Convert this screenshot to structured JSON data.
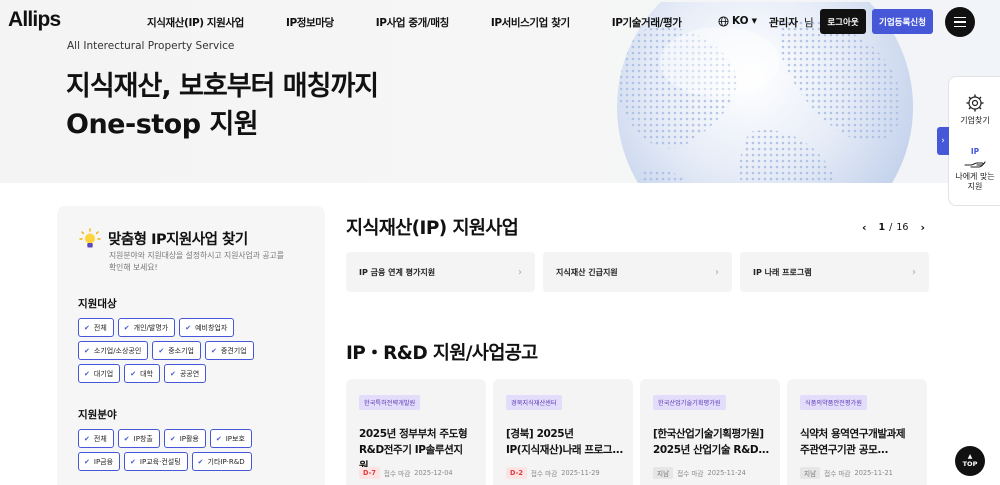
{
  "header": {
    "logo": "Allips",
    "nav": [
      {
        "label": "지식재산(IP) 지원사업"
      },
      {
        "label": "IP정보마당"
      },
      {
        "label": "IP사업 중개/매칭"
      },
      {
        "label": "IP서비스기업 찾기"
      },
      {
        "label": "IP기술거래/평가"
      }
    ],
    "language": "KO",
    "user_name": "관리자",
    "user_suffix": "님",
    "logout_label": "로그아웃",
    "register_label": "기업등록신청"
  },
  "hero": {
    "subtitle": "All Interectural Property Service",
    "title_line1": "지식재산, 보호부터 매칭까지",
    "title_line2": "One-stop 지원"
  },
  "quick_menu": {
    "find_company": "기업찾기",
    "ip_badge": "IP",
    "custom_support_line1": "나에게 맞는",
    "custom_support_line2": "지원"
  },
  "filter": {
    "title": "맞춤형 IP지원사업 찾기",
    "desc_line1": "지원분야와 지원대상을 설정하시고 지원사업과 공고를",
    "desc_line2": "확인해 보세요!",
    "target_title": "지원대상",
    "targets": [
      "전체",
      "개인/발명가",
      "예비창업자",
      "소기업/소상공인",
      "중소기업",
      "중견기업",
      "대기업",
      "대학",
      "공공연"
    ],
    "field_title": "지원분야",
    "fields": [
      "전체",
      "IP창출",
      "IP활용",
      "IP보호",
      "IP금융",
      "IP교육·컨설팅",
      "기타IP·R&D"
    ]
  },
  "programs": {
    "title": "지식재산(IP) 지원사업",
    "page_current": "1",
    "page_sep": "/",
    "page_total": "16",
    "items": [
      {
        "label": "IP 금융 연계 평가지원"
      },
      {
        "label": "지식재산 긴급지원"
      },
      {
        "label": "IP 나래 프로그램"
      }
    ]
  },
  "notices": {
    "title": "IP・R&D 지원/사업공고",
    "deadline_prefix": "접수 마감",
    "items": [
      {
        "org": "한국특허전략개발원",
        "title_line1": "2025년 정부부처 주도형",
        "title_line2": "R&D전주기 IP솔루션지원...",
        "status": "D-7",
        "status_type": "red",
        "deadline": "2025-12-04"
      },
      {
        "org": "경북지식재산센터",
        "title_line1": "[경북] 2025년",
        "title_line2": "IP(지식재산)나래 프로그...",
        "status": "D-2",
        "status_type": "red",
        "deadline": "2025-11-29"
      },
      {
        "org": "한국산업기술기획평가원",
        "title_line1": "[한국산업기술기획평가원]",
        "title_line2": "2025년 산업기술 R&D...",
        "status": "지남",
        "status_type": "gray",
        "deadline": "2025-11-24"
      },
      {
        "org": "식품의약품안전평가원",
        "title_line1": "식약처 용역연구개발과제",
        "title_line2": "주관연구기관 공모...",
        "status": "지남",
        "status_type": "gray",
        "deadline": "2025-11-21"
      }
    ]
  },
  "top_button": "TOP",
  "colors": {
    "accent": "#4658d8",
    "danger": "#e23b3b",
    "tag_bg": "#e3dcfa"
  }
}
